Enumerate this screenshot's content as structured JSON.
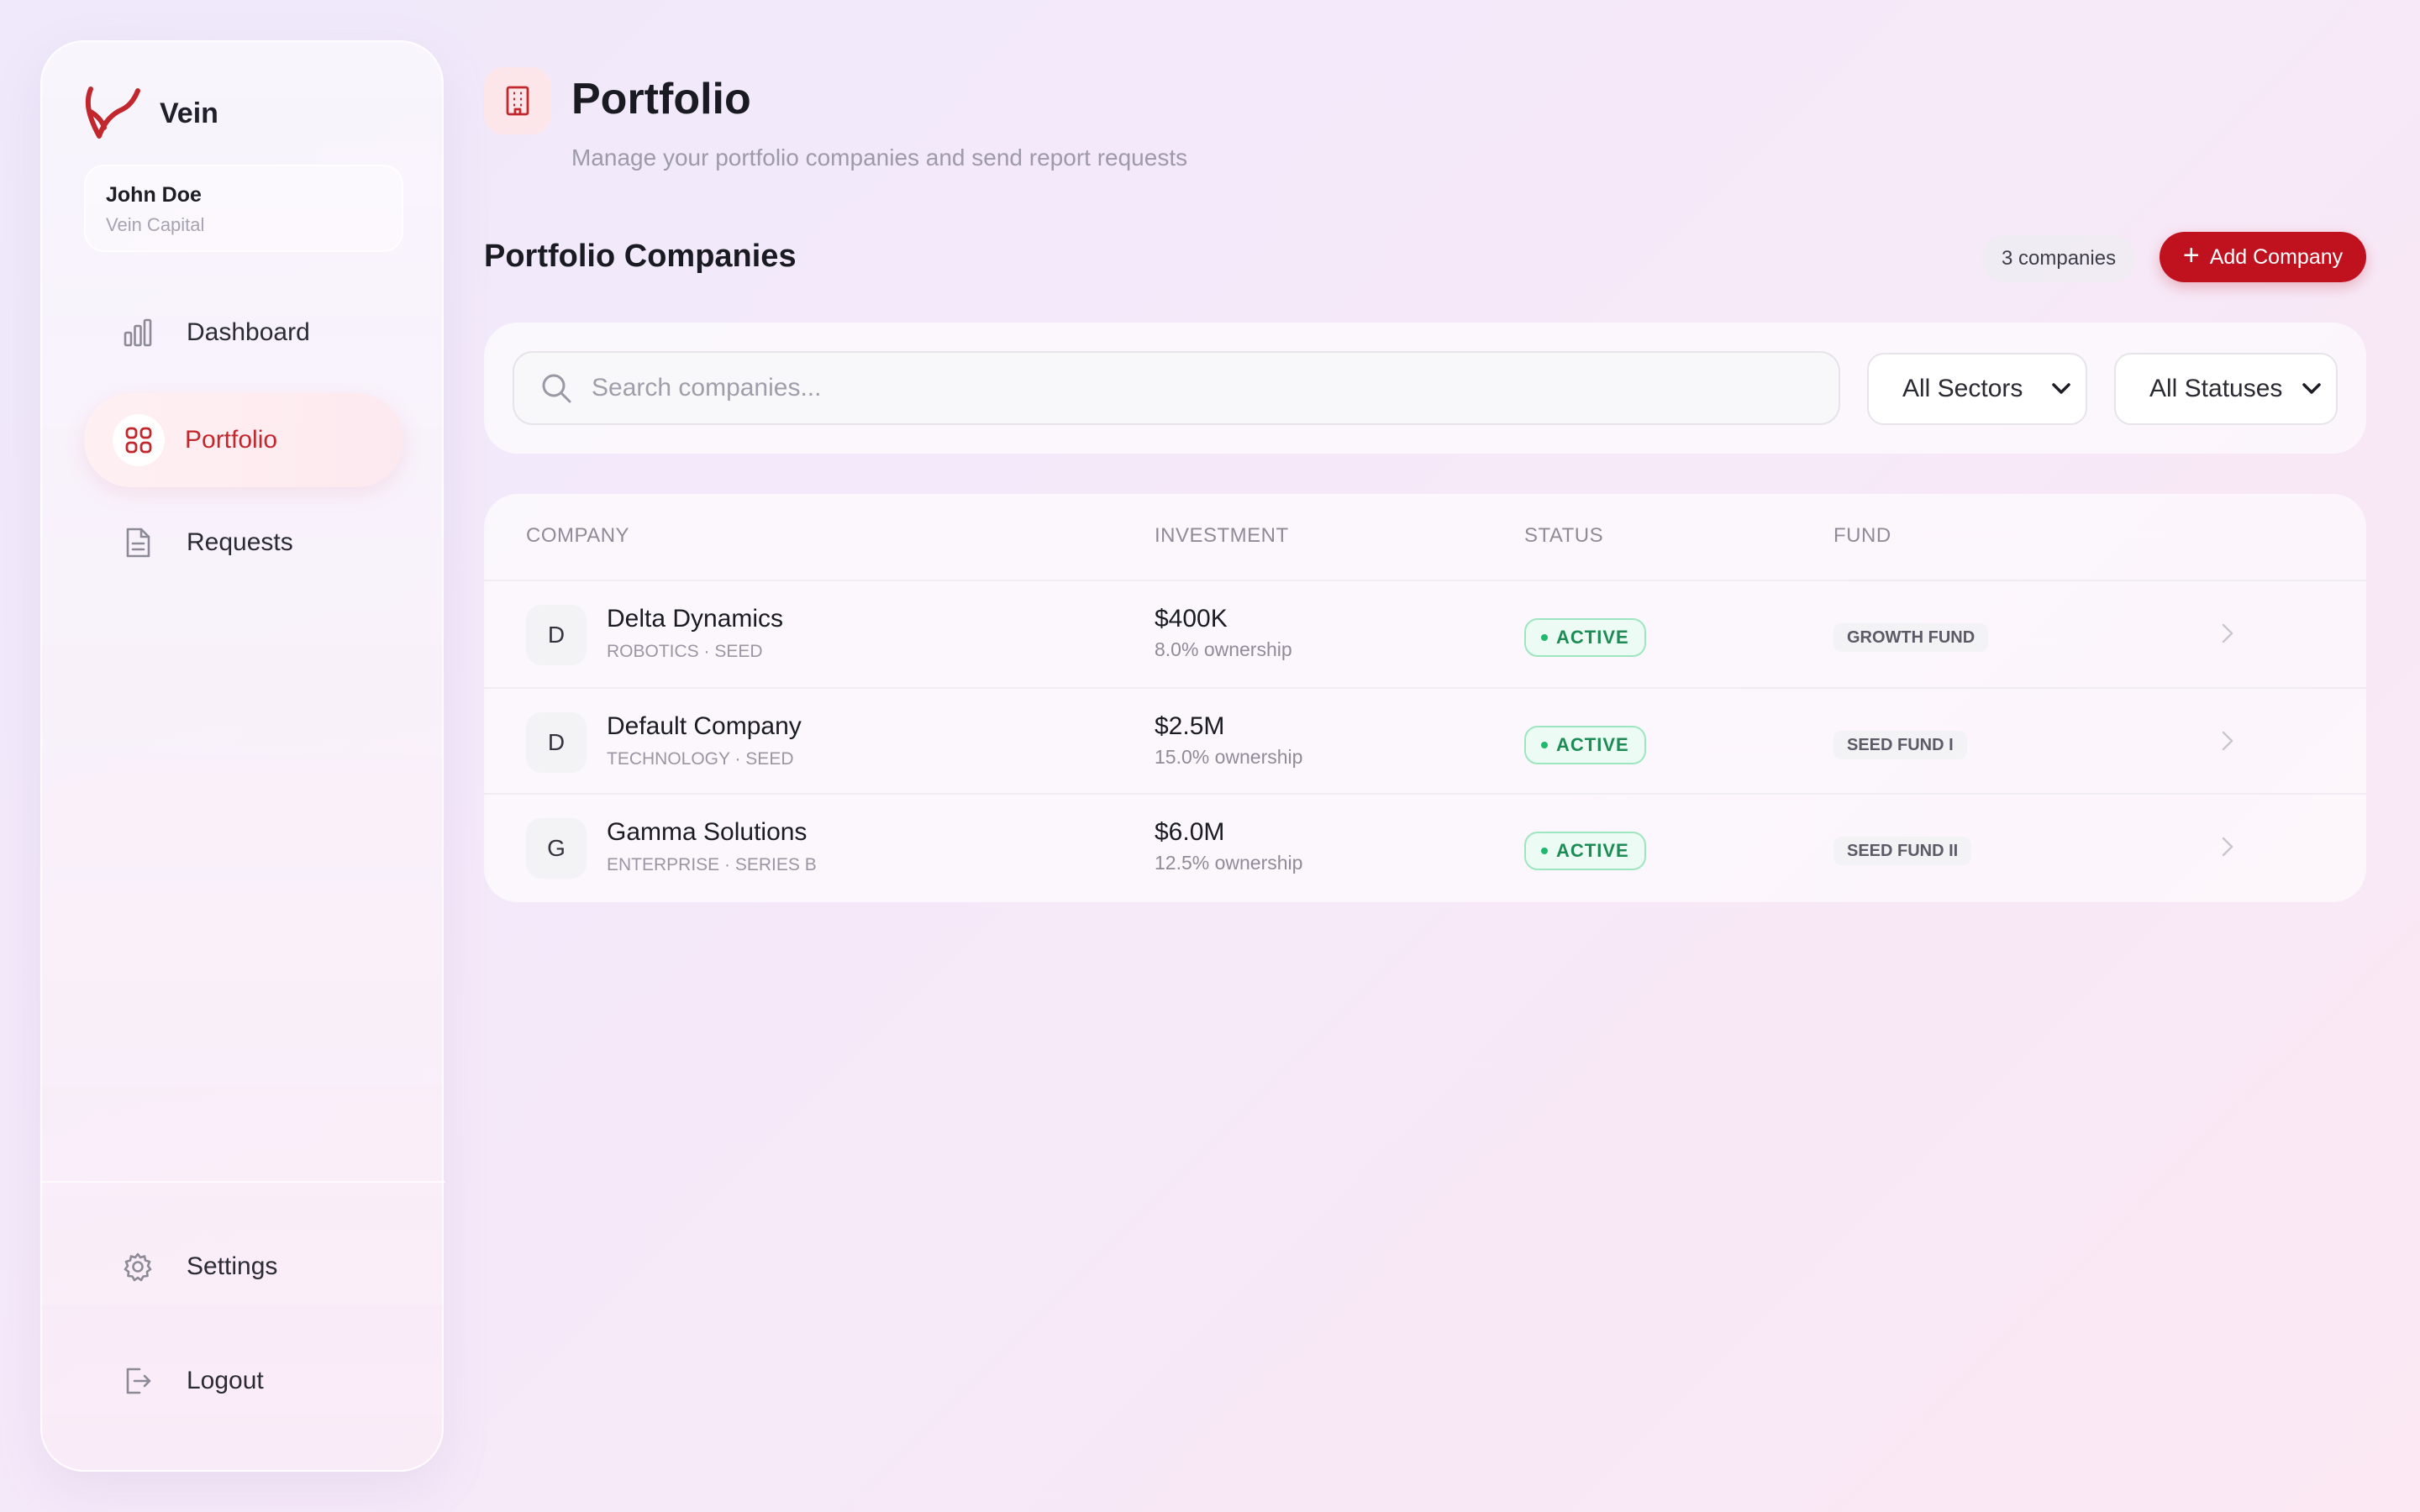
{
  "brand": {
    "name": "Vein",
    "accent": "#c1272d"
  },
  "user": {
    "name": "John Doe",
    "org": "Vein Capital"
  },
  "nav": {
    "items": [
      {
        "label": "Dashboard",
        "icon": "bar-chart-icon",
        "active": false
      },
      {
        "label": "Portfolio",
        "icon": "grid-icon",
        "active": true
      },
      {
        "label": "Requests",
        "icon": "document-icon",
        "active": false
      }
    ],
    "bottom": [
      {
        "label": "Settings",
        "icon": "gear-icon"
      },
      {
        "label": "Logout",
        "icon": "logout-icon"
      }
    ]
  },
  "header": {
    "title": "Portfolio",
    "subtitle": "Manage your portfolio companies and send report requests",
    "icon": "building-icon"
  },
  "section": {
    "title": "Portfolio Companies",
    "count_label": "3 companies",
    "add_button": "Add Company"
  },
  "filters": {
    "search_placeholder": "Search companies...",
    "sector": "All Sectors",
    "status": "All Statuses"
  },
  "table": {
    "headers": {
      "company": "COMPANY",
      "investment": "INVESTMENT",
      "status": "STATUS",
      "fund": "FUND"
    },
    "rows": [
      {
        "initial": "D",
        "name": "Delta Dynamics",
        "meta": "ROBOTICS · SEED",
        "amount": "$400K",
        "ownership": "8.0% ownership",
        "status": "ACTIVE",
        "fund": "GROWTH FUND"
      },
      {
        "initial": "D",
        "name": "Default Company",
        "meta": "TECHNOLOGY · SEED",
        "amount": "$2.5M",
        "ownership": "15.0% ownership",
        "status": "ACTIVE",
        "fund": "SEED FUND I"
      },
      {
        "initial": "G",
        "name": "Gamma Solutions",
        "meta": "ENTERPRISE · SERIES B",
        "amount": "$6.0M",
        "ownership": "12.5% ownership",
        "status": "ACTIVE",
        "fund": "SEED FUND II"
      }
    ]
  },
  "colors": {
    "primary": "#c0111f",
    "active_status": "#1c8b54"
  }
}
